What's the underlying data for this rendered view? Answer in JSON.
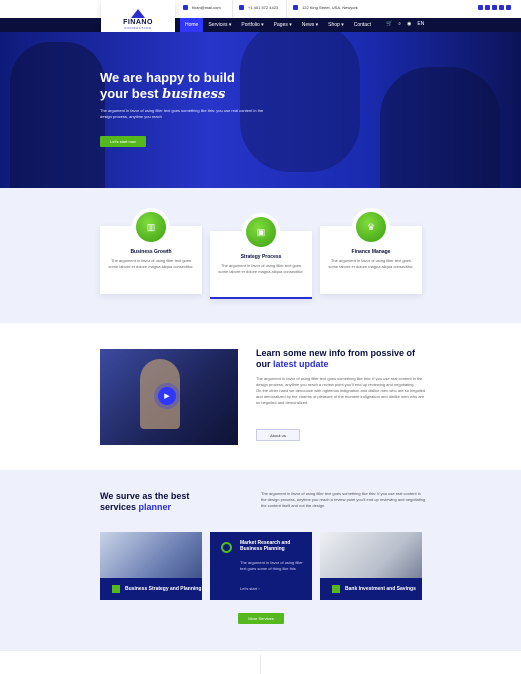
{
  "topbar": {
    "email": "finan@mail.com",
    "phone": "+1 401 572 4423",
    "address": "122 King Street, USA, Newyork",
    "social_icons": [
      "facebook-icon",
      "twitter-icon",
      "google-icon",
      "linkedin-icon",
      "instagram-icon"
    ]
  },
  "logo": {
    "name": "FINANO",
    "sub": "CONSULTING"
  },
  "nav": {
    "items": [
      "Home",
      "Services ▾",
      "Portfolio ▾",
      "Pages ▾",
      "News ▾",
      "Shop ▾",
      "Contact"
    ],
    "active": "Home",
    "icons": [
      "cart-icon",
      "search-icon",
      "flag-icon"
    ],
    "lang": "EN"
  },
  "hero": {
    "title_line1": "We are happy to build",
    "title_line2": "your best ",
    "title_italic": "business",
    "desc": "The argument in favor of using filler text goes something like this: you use real content in the design process, anytime you reach",
    "button": "Let's start now"
  },
  "features": [
    {
      "title": "Business Growth",
      "desc": "The argument in favor of using filler text goes some labore et dolore magna aliqua consectitur.",
      "icon": "chart-icon"
    },
    {
      "title": "Strategy Process",
      "desc": "The argument in favor of using filler text goes some labore et dolore magna aliqua consectitur.",
      "icon": "presentation-icon"
    },
    {
      "title": "Finance Manage",
      "desc": "The argument in favor of using filler text goes some labore et dolore magna aliqua consectitur.",
      "icon": "crown-icon"
    }
  ],
  "news": {
    "title_line1": "Learn some new info from possive of",
    "title_line2_plain": "our ",
    "title_line2_highlight": "latest update",
    "desc1": "The argument in favor of using filler text goes something like this: If you use real content in the design process, anytime you reach a review point you'll end up reviewing and negotiating.",
    "desc2": "On the other hand we denounce with righteous indignation and dislike men who are so beguiled and demoralized by the charms of pleasure of the moment indignation and dislike men who are so beguiled and demoralized.",
    "button": "About us"
  },
  "services": {
    "title_line1": "We surve as the best",
    "title_line2_plain": "services ",
    "title_line2_highlight": "planner",
    "desc": "The argument in favor of using filler text goes something like this: If you use real content in the design process, anytime you reach a review point you'll end up reviewing and negotiating the content itself and not the design.",
    "cards": [
      {
        "title": "Business Strategy and Planning"
      },
      {
        "title": "Market Research and Business Planning",
        "desc": "The argument in favor of using filler text goes some of thing like this",
        "link": "Let's start ›"
      },
      {
        "title": "Bank Investment and Savings"
      }
    ],
    "button": "More Services"
  },
  "colors": {
    "accent": "#2b2fd1",
    "navy": "#0a0f3c",
    "green": "#55b91e"
  }
}
